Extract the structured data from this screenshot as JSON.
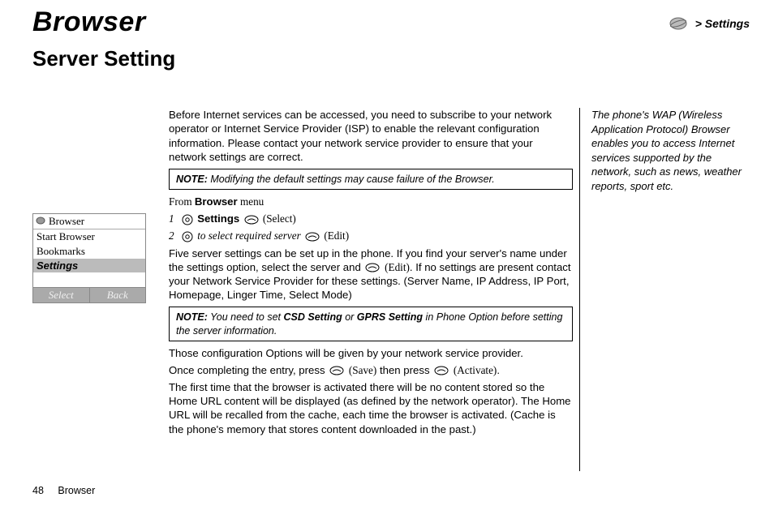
{
  "header": {
    "title": "Browser",
    "breadcrumb": "> Settings"
  },
  "section_heading": "Server Setting",
  "intro": "Before Internet services can be accessed, you need to subscribe to your network operator or Internet Service Provider (ISP) to enable the relevant configuration information. Please contact your network service provider to ensure that your network settings are correct.",
  "note1": {
    "label": "NOTE:",
    "body": " Modifying the default settings may cause failure of the Browser."
  },
  "from_prefix": "From ",
  "from_bold": "Browser",
  "from_suffix": " menu",
  "steps": [
    {
      "num": "1",
      "bold": "Settings",
      "action": "(Select)"
    },
    {
      "num": "2",
      "text": "to select required server",
      "action": "(Edit)"
    }
  ],
  "para2a": "Five server settings can be set up in the phone. If you find your server's name under the settings option, select the server and",
  "para2_edit": "(Edit)",
  "para2b": ". If no settings are present contact your Network Service Provider for these settings. (Server Name, IP Address, IP Port, Homepage, Linger Time, Select Mode)",
  "note2": {
    "label": "NOTE:",
    "prefix": " You need to set ",
    "b1": "CSD Setting",
    "mid": " or ",
    "b2": "GPRS Setting",
    "suffix": " in Phone Option before setting the server information."
  },
  "para3": "Those configuration Options will be given by your network service provider.",
  "para4_a": "Once completing the entry, press ",
  "para4_save": "(Save)",
  "para4_b": " then press ",
  "para4_activate": "(Activate)",
  "para4_c": ".",
  "para5": "The first time that the browser is activated there will be no content stored so the Home URL content will be displayed (as defined by the network operator). The Home URL will be recalled from the cache, each time the browser is activated. (Cache is the phone's memory that stores content downloaded in the past.)",
  "sidebar_note": "The phone's WAP (Wireless Application Protocol) Browser enables you to access Internet services supported by the network, such as news, weather reports, sport etc.",
  "phone": {
    "title": "Browser",
    "items": [
      "Start Browser",
      "Bookmarks",
      "Settings"
    ],
    "selected_index": 2,
    "soft_left": "Select",
    "soft_right": "Back"
  },
  "footer": {
    "page": "48",
    "label": "Browser"
  }
}
